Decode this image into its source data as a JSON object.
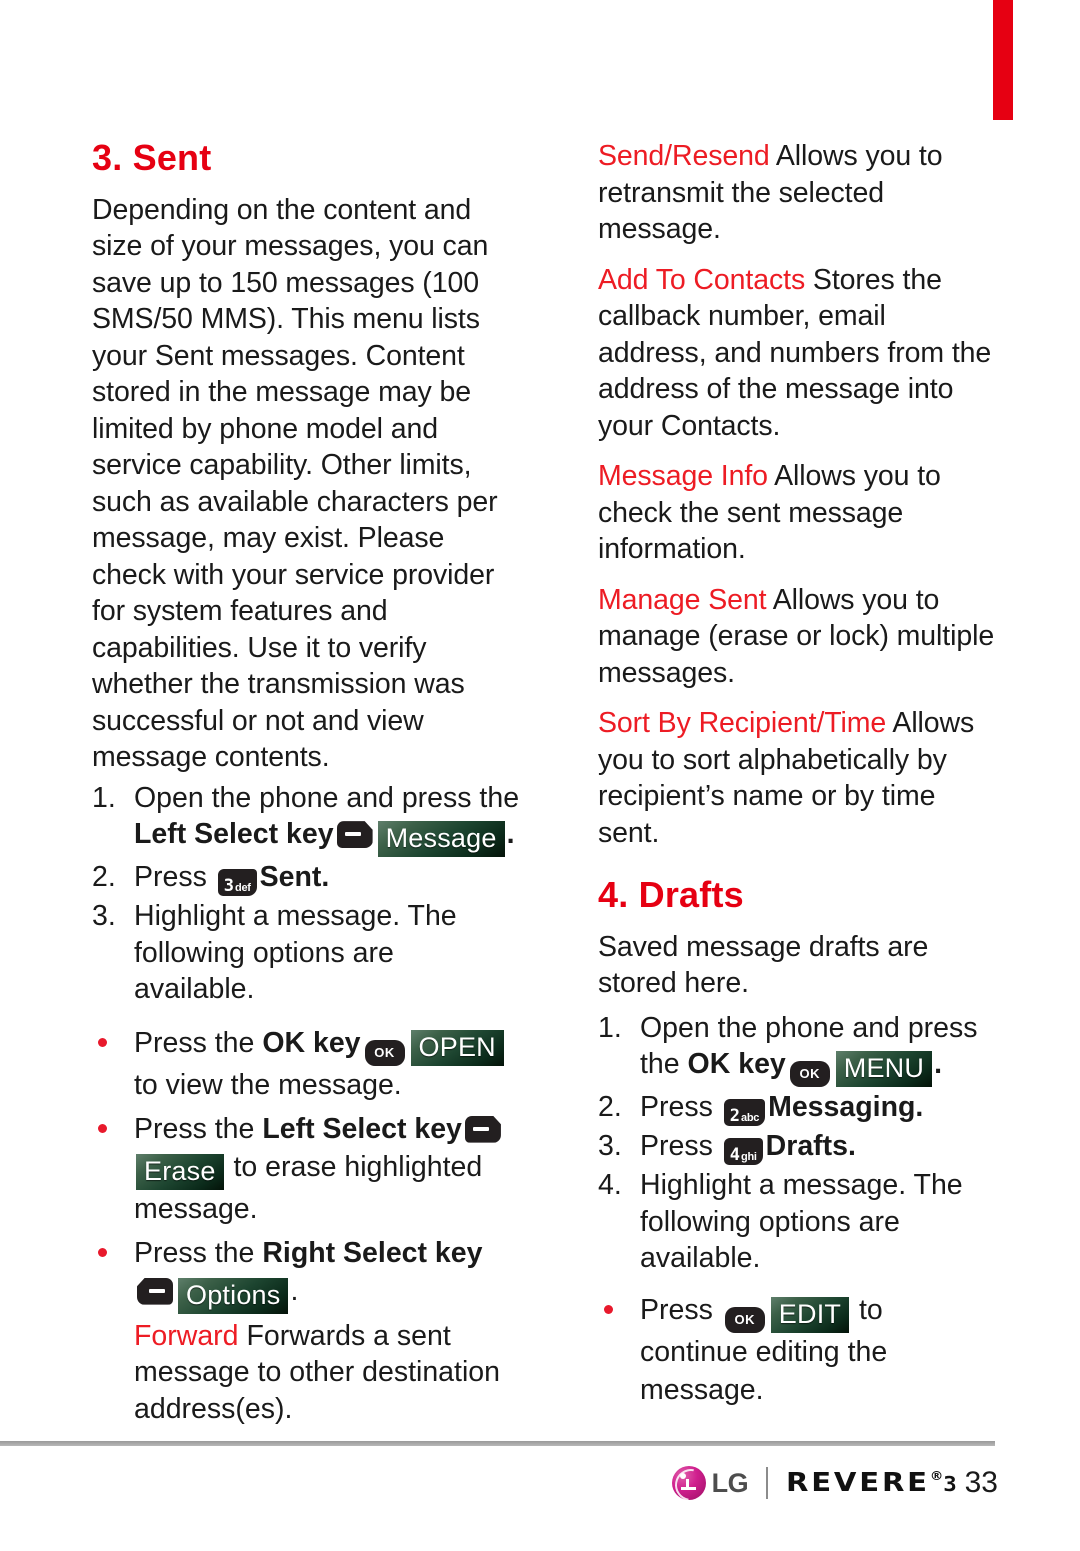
{
  "page": {
    "number": "33",
    "brand": {
      "lg_text": "LG",
      "model": "REVERE",
      "registered_mark": "®",
      "model_number": "3"
    }
  },
  "left_column": {
    "section": {
      "heading": "3. Sent",
      "intro": "Depending on the content and size of your messages, you can save up to 150 messages (100 SMS/50 MMS). This menu lists your Sent messages. Content stored in the message may be limited by phone model and service capability. Other limits, such as available characters per message, may exist. Please check with your service provider for system features and capabilities. Use it to verify whether the transmission was successful or not and view message contents."
    },
    "steps": [
      {
        "num": "1.",
        "text_before": "Open the phone and press the ",
        "bold_label": "Left Select key",
        "key_icon": "left-select-key-icon",
        "badge": "Message",
        "text_after": "."
      },
      {
        "num": "2.",
        "text_before": "Press ",
        "key_digit": "3",
        "key_letters": "def",
        "bold_label": "Sent",
        "text_after": "."
      },
      {
        "num": "3.",
        "text_before": "Highlight a message. The following options are available.",
        "bold_label": "",
        "text_after": ""
      }
    ],
    "bullets": [
      {
        "text_before": "Press the ",
        "bold_label": "OK key",
        "key_icon": "ok-key-icon",
        "key_label": "OK",
        "badge": "OPEN",
        "text_after": " to view the message."
      },
      {
        "text_before": "Press the ",
        "bold_label": "Left Select key",
        "key_icon": "left-select-key-icon",
        "badge": "Erase",
        "text_after": " to erase highlighted message."
      },
      {
        "text_before": "Press the ",
        "bold_label": "Right Select key",
        "key_icon": "right-select-key-icon",
        "badge": "Options",
        "text_after": "."
      }
    ],
    "forward_option": {
      "term": "Forward",
      "description": " Forwards a sent message to other destination address(es)."
    }
  },
  "right_column": {
    "options": [
      {
        "term": "Send/Resend",
        "description": " Allows you to retransmit the selected message."
      },
      {
        "term": "Add To Contacts",
        "description": " Stores the callback number, email address, and numbers from the address of the message into your Contacts."
      },
      {
        "term": "Message Info",
        "description": " Allows you to check the sent message information."
      },
      {
        "term": "Manage Sent",
        "description": " Allows you to manage (erase or lock) multiple messages."
      },
      {
        "term": "Sort By Recipient/Time",
        "description": " Allows you to sort alphabetically by recipient’s name or by time sent."
      }
    ],
    "section": {
      "heading": "4. Drafts",
      "intro": "Saved message drafts are stored here."
    },
    "steps": [
      {
        "num": "1.",
        "text_before": "Open the phone and press the ",
        "bold_label": "OK key",
        "key_icon": "ok-key-icon",
        "key_label": "OK",
        "badge": "MENU",
        "text_after": "."
      },
      {
        "num": "2.",
        "text_before": "Press ",
        "key_digit": "2",
        "key_letters": "abc",
        "bold_label": "Messaging",
        "text_after": "."
      },
      {
        "num": "3.",
        "text_before": "Press ",
        "key_digit": "4",
        "key_letters": "ghi",
        "bold_label": "Drafts",
        "text_after": "."
      },
      {
        "num": "4.",
        "text_before": "Highlight a message. The following options are available.",
        "bold_label": "",
        "text_after": ""
      }
    ],
    "bullets": [
      {
        "text_before": "Press ",
        "key_icon": "ok-key-icon",
        "key_label": "OK",
        "badge": "EDIT",
        "text_after": " to continue editing the message."
      }
    ]
  },
  "colors": {
    "accent_red": "#E60012",
    "term_red": "#ED1C24",
    "badge_green_light": "#5f7f6b",
    "badge_green_dark": "#041208",
    "key_dark": "#231F20",
    "lg_magenta": "#d01f8e"
  }
}
